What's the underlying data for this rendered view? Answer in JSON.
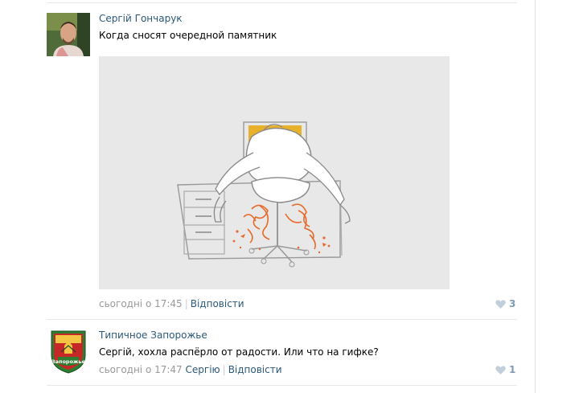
{
  "comments": [
    {
      "author": "Сергій Гончарук",
      "text": "Когда сносят очередной памятник",
      "time": "сьогодні о 17:45",
      "reply_to": "",
      "reply_label": "Відповісти",
      "likes": "3"
    },
    {
      "author": "Типичное Запорожье",
      "text": "Сергій, хохла распёрло от радости. Или что на гифке?",
      "time": "сьогодні о 17:47",
      "reply_to": "Сергію",
      "reply_label": "Відповісти",
      "likes": "1",
      "avatar_caption": "Запорожье"
    }
  ],
  "colors": {
    "link": "#2b587a",
    "meta": "#999999",
    "like": "#7f9bb6",
    "gif_bg": "#e8e8e8",
    "accent_orange": "#e8692a",
    "chair_yellow": "#e8b12c"
  }
}
